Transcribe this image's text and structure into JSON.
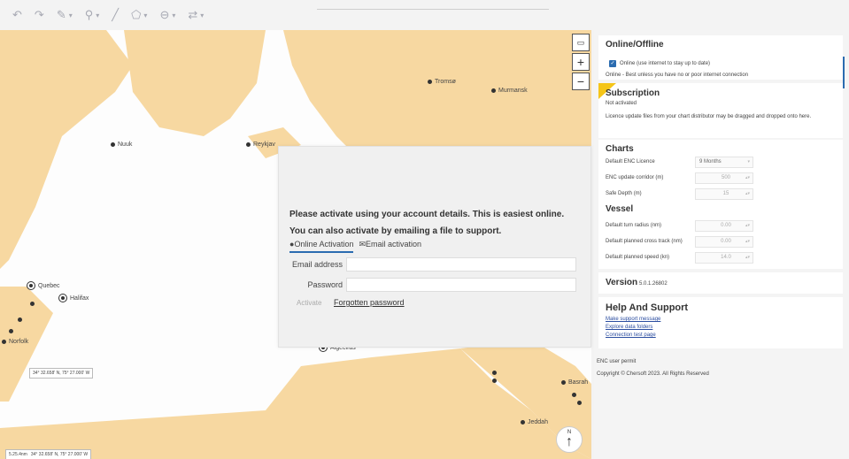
{
  "toolbar": {
    "icons": [
      "undo-icon",
      "redo-icon",
      "pencil-icon",
      "pin-icon",
      "line-icon",
      "polygon-icon",
      "layers-icon",
      "route-icon"
    ]
  },
  "map": {
    "land_color": "#f7d8a1",
    "cities": [
      {
        "name": "Tromsø"
      },
      {
        "name": "Murmansk"
      },
      {
        "name": "Nuuk"
      },
      {
        "name": "Reykjav"
      },
      {
        "name": "Quebec"
      },
      {
        "name": "Halifax"
      },
      {
        "name": "Norfolk"
      },
      {
        "name": "Algeciras"
      },
      {
        "name": "Basrah"
      },
      {
        "name": "Jeddah"
      }
    ],
    "coord_readout": "34° 32.658' N, 75° 27.000' W",
    "scale_readout": "5.25.4nm",
    "cursor_readout": "34° 32.658' N, 75° 27.000' W",
    "north_label": "N"
  },
  "dialog": {
    "line1": "Please activate using your account details. This is easiest online.",
    "line2": "You can also activate by emailing a file to support.",
    "tab_online": "Online Activation",
    "tab_email": "Email activation",
    "email_label": "Email address",
    "password_label": "Password",
    "activate_label": "Activate",
    "forgot_label": "Forgotten password"
  },
  "panel": {
    "online": {
      "title": "Online/Offline",
      "checkbox_label": "Online (use internet to stay up to date)",
      "note": "Online - Best unless you have no or poor internet connection"
    },
    "subscription": {
      "title": "Subscription",
      "status": "Not activated",
      "note": "Licence update files from your chart distributor may be dragged and dropped onto here."
    },
    "charts": {
      "title": "Charts",
      "enc_label": "Default ENC Licence",
      "enc_value": "9 Months",
      "corridor_label": "ENC update corridor (m)",
      "corridor_value": "500",
      "depth_label": "Safe Depth (m)",
      "depth_value": "15"
    },
    "vessel": {
      "title": "Vessel",
      "turn_label": "Default turn radius (nm)",
      "turn_value": "0.00",
      "xtrack_label": "Default planned cross track (nm)",
      "xtrack_value": "0.00",
      "speed_label": "Default planned speed (kn)",
      "speed_value": "14.0"
    },
    "version": {
      "title": "Version",
      "value": "5.0.1.26802"
    },
    "help": {
      "title": "Help And Support",
      "link1": "Make support message",
      "link2": "Explore data folders",
      "link3": "Connection test page"
    },
    "enc_permit": "ENC user permit",
    "copyright": "Copyright © Chersoft 2023. All Rights Reserved"
  }
}
